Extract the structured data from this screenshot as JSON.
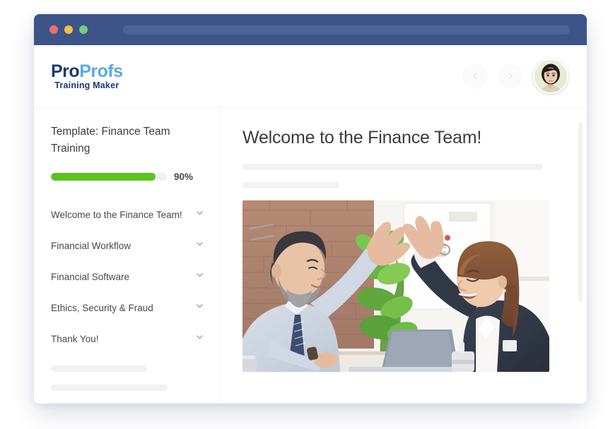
{
  "window": {
    "title_bar": {
      "traffic_lights": [
        "close-red",
        "minimize-yellow",
        "maximize-green"
      ],
      "address_bar_value": "",
      "colors": {
        "bar": "#3d5488",
        "address": "#4d6399",
        "red": "#e8716d",
        "yellow": "#f0c04a",
        "green": "#72cd7f"
      }
    }
  },
  "header": {
    "logo": {
      "part1": "Pro",
      "part2": "Profs",
      "tagline": "Training Maker",
      "color_part1": "#1b3a72",
      "color_part2": "#5ba9e6"
    },
    "nav": {
      "prev_icon": "chevron-left-icon",
      "next_icon": "chevron-right-icon"
    },
    "avatar_alt": "user-avatar"
  },
  "sidebar": {
    "template_title": "Template: Finance Team Training",
    "progress": {
      "percent": 90,
      "label": "90%",
      "fill_color": "#5dc21e",
      "track_color": "#f0f0f2"
    },
    "menu": [
      {
        "label": "Welcome to the Finance Team!",
        "icon": "chevron-down-icon"
      },
      {
        "label": "Financial Workflow",
        "icon": "chevron-down-icon"
      },
      {
        "label": "Financial Software",
        "icon": "chevron-down-icon"
      },
      {
        "label": "Ethics, Security & Fraud",
        "icon": "chevron-down-icon"
      },
      {
        "label": "Thank You!",
        "icon": "chevron-down-icon"
      }
    ],
    "skeleton_widths": [
      "136px",
      "165px",
      "165px"
    ]
  },
  "main": {
    "title": "Welcome to the Finance Team!",
    "skeleton_widths": [
      "425px",
      "137px"
    ],
    "hero_image_alt": "two-colleagues-high-fiving-in-office",
    "scrollbar": {
      "visible": true,
      "color": "#f2f1f4"
    }
  }
}
